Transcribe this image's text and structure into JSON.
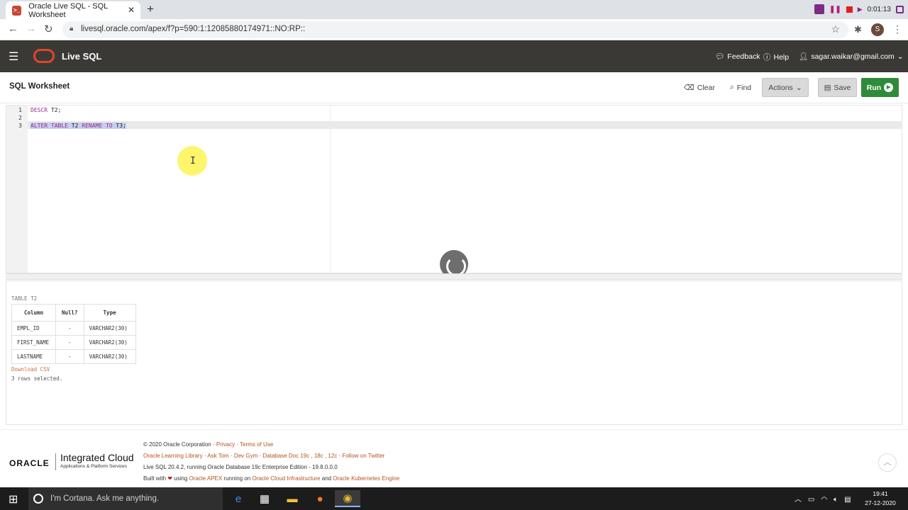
{
  "browser": {
    "tab_title": "Oracle Live SQL - SQL Worksheet",
    "url": "livesql.oracle.com/apex/f?p=590:1:12085880174971::NO:RP::",
    "profile_initial": "S",
    "recording_time": "0:01:13"
  },
  "header": {
    "app_title": "Live SQL",
    "feedback": "Feedback",
    "help": "Help",
    "user": "sagar.waikar@gmail.com"
  },
  "toolbar": {
    "title": "SQL Worksheet",
    "clear": "Clear",
    "find": "Find",
    "actions": "Actions",
    "save": "Save",
    "run": "Run"
  },
  "editor": {
    "line_numbers": [
      "1",
      "2",
      "3"
    ],
    "line1_kw": "DESCR",
    "line1_rest": " T2;",
    "line3_kw1": "ALTER TABLE",
    "line3_obj1": " T2 ",
    "line3_kw2": "RENAME TO",
    "line3_rest": " T3;"
  },
  "results": {
    "caption": "TABLE T2",
    "columns": [
      "Column",
      "Null?",
      "Type"
    ],
    "rows": [
      [
        "EMPL_ID",
        "-",
        "VARCHAR2(30)"
      ],
      [
        "FIRST_NAME",
        "-",
        "VARCHAR2(30)"
      ],
      [
        "LASTNAME",
        "-",
        "VARCHAR2(30)"
      ]
    ],
    "download": "Download CSV",
    "rows_selected": "3 rows selected."
  },
  "footer": {
    "oracle": "ORACLE",
    "brand_big": "Integrated Cloud",
    "brand_small": "Applications & Platform Services",
    "copyright": "© 2020 Oracle Corporation · ",
    "privacy": "Privacy",
    "sep": " · ",
    "terms": "Terms of Use",
    "links": [
      "Oracle Learning Library",
      "Ask Tom",
      "Dev Gym",
      "Database Doc 19c , 18c , 12c",
      "Follow on Twitter"
    ],
    "version": "Live SQL 20.4.2, running Oracle Database 19c Enterprise Edition - 19.8.0.0.0",
    "built_prefix": "Built with ",
    "built_using": " using ",
    "apex": "Oracle APEX",
    "running_on": " running on ",
    "oci": "Oracle Cloud Infrastructure",
    "and": " and ",
    "oke": "Oracle Kubernetes Engine"
  },
  "taskbar": {
    "cortana": "I'm Cortana. Ask me anything.",
    "time": "19:41",
    "date": "27-12-2020"
  }
}
